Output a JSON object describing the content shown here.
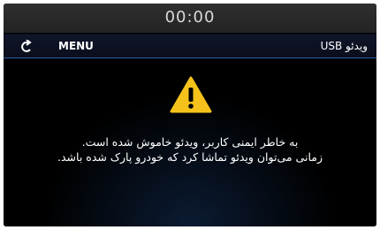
{
  "status_bar": {
    "clock": "00:00"
  },
  "nav_bar": {
    "back_icon": "back-arrow-icon",
    "menu_label": "MENU",
    "title": "ویدئو USB"
  },
  "content": {
    "icon": "warning-icon",
    "icon_color": "#f5c21b",
    "message_line1": "به خاطر ایمنی کاربر، ویدئو خاموش شده است.",
    "message_line2": "زمانی می‌توان ویدئو تماشا کرد که خودرو پارک شده باشد."
  }
}
